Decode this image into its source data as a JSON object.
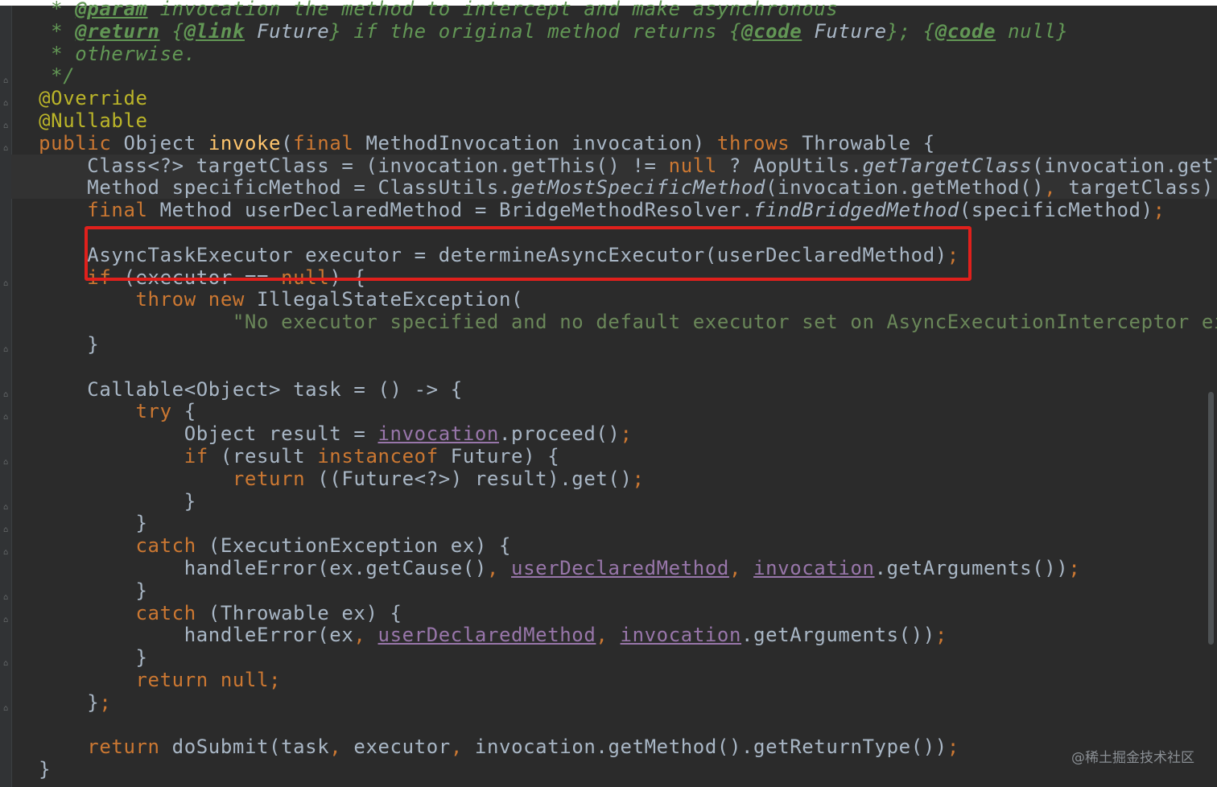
{
  "watermark": "@稀土掘金技术社区",
  "lines": [
    [
      [
        "cmt",
        "   * "
      ],
      [
        "tag",
        "@param"
      ],
      [
        "cmt",
        " invocation the method to intercept and make asynchronous"
      ]
    ],
    [
      [
        "cmt",
        "   * "
      ],
      [
        "tag",
        "@return"
      ],
      [
        "cmt",
        " {"
      ],
      [
        "tag",
        "@link"
      ],
      [
        "cmt",
        " "
      ],
      [
        "cmtp",
        "Future"
      ],
      [
        "cmt",
        "} if the original method returns {"
      ],
      [
        "tag",
        "@code"
      ],
      [
        "cmt",
        " "
      ],
      [
        "cmtp",
        "Future"
      ],
      [
        "cmt",
        "}; {"
      ],
      [
        "tag",
        "@code"
      ],
      [
        "cmt",
        " null}"
      ]
    ],
    [
      [
        "cmt",
        "   * otherwise."
      ]
    ],
    [
      [
        "cmt",
        "   */"
      ]
    ],
    [
      [
        "ann",
        "  @Override"
      ]
    ],
    [
      [
        "ann",
        "  @Nullable"
      ]
    ],
    [
      [
        "kw",
        "  public"
      ],
      [
        "p",
        " Object "
      ],
      [
        "fn",
        "invoke"
      ],
      [
        "p",
        "("
      ],
      [
        "kw",
        "final"
      ],
      [
        "p",
        " MethodInvocation invocation) "
      ],
      [
        "kw",
        "throws"
      ],
      [
        "p",
        " Throwable {"
      ]
    ],
    [
      [
        "p",
        "      Class<?> targetClass = (invocation.getThis() != "
      ],
      [
        "kw",
        "null"
      ],
      [
        "p",
        " ? AopUtils."
      ],
      [
        "st",
        "getTargetClass"
      ],
      [
        "p",
        "(invocation.getTh"
      ]
    ],
    [
      [
        "p",
        "      Method specificMethod = ClassUtils."
      ],
      [
        "st",
        "getMostSpecificMethod"
      ],
      [
        "p",
        "(invocation.getMethod()"
      ],
      [
        "kw",
        ","
      ],
      [
        "p",
        " targetClass)"
      ],
      [
        "kw",
        ";"
      ]
    ],
    [
      [
        "kw",
        "      final"
      ],
      [
        "p",
        " Method userDeclaredMethod = BridgeMethodResolver."
      ],
      [
        "st",
        "findBridgedMethod"
      ],
      [
        "p",
        "(specificMethod)"
      ],
      [
        "kw",
        ";"
      ]
    ],
    [
      [
        "p",
        ""
      ]
    ],
    [
      [
        "p",
        "      AsyncTaskExecutor executor = determineAsyncExecutor(userDeclaredMethod)"
      ],
      [
        "kw",
        ";"
      ]
    ],
    [
      [
        "kw",
        "      if"
      ],
      [
        "p",
        " (executor == "
      ],
      [
        "kw",
        "null"
      ],
      [
        "p",
        ") {"
      ]
    ],
    [
      [
        "kw",
        "          throw new"
      ],
      [
        "p",
        " IllegalStateException("
      ]
    ],
    [
      [
        "str",
        "                  \"No executor specified and no default executor set on AsyncExecutionInterceptor ei"
      ]
    ],
    [
      [
        "p",
        "      }"
      ]
    ],
    [
      [
        "p",
        ""
      ]
    ],
    [
      [
        "p",
        "      Callable<Object> task = () -> {"
      ]
    ],
    [
      [
        "kw",
        "          try"
      ],
      [
        "p",
        " {"
      ]
    ],
    [
      [
        "p",
        "              Object result = "
      ],
      [
        "fld",
        "invocation"
      ],
      [
        "p",
        ".proceed()"
      ],
      [
        "kw",
        ";"
      ]
    ],
    [
      [
        "kw",
        "              if"
      ],
      [
        "p",
        " (result "
      ],
      [
        "kw",
        "instanceof"
      ],
      [
        "p",
        " Future) {"
      ]
    ],
    [
      [
        "kw",
        "                  return"
      ],
      [
        "p",
        " ((Future<?>) result).get()"
      ],
      [
        "kw",
        ";"
      ]
    ],
    [
      [
        "p",
        "              }"
      ]
    ],
    [
      [
        "p",
        "          }"
      ]
    ],
    [
      [
        "kw",
        "          catch"
      ],
      [
        "p",
        " (ExecutionException ex) {"
      ]
    ],
    [
      [
        "p",
        "              handleError(ex.getCause()"
      ],
      [
        "kw",
        ","
      ],
      [
        "p",
        " "
      ],
      [
        "fld",
        "userDeclaredMethod"
      ],
      [
        "kw",
        ","
      ],
      [
        "p",
        " "
      ],
      [
        "fld",
        "invocation"
      ],
      [
        "p",
        ".getArguments())"
      ],
      [
        "kw",
        ";"
      ]
    ],
    [
      [
        "p",
        "          }"
      ]
    ],
    [
      [
        "kw",
        "          catch"
      ],
      [
        "p",
        " (Throwable ex) {"
      ]
    ],
    [
      [
        "p",
        "              handleError(ex"
      ],
      [
        "kw",
        ","
      ],
      [
        "p",
        " "
      ],
      [
        "fld",
        "userDeclaredMethod"
      ],
      [
        "kw",
        ","
      ],
      [
        "p",
        " "
      ],
      [
        "fld",
        "invocation"
      ],
      [
        "p",
        ".getArguments())"
      ],
      [
        "kw",
        ";"
      ]
    ],
    [
      [
        "p",
        "          }"
      ]
    ],
    [
      [
        "kw",
        "          return null;"
      ]
    ],
    [
      [
        "p",
        "      }"
      ],
      [
        "kw",
        ";"
      ]
    ],
    [
      [
        "p",
        ""
      ]
    ],
    [
      [
        "kw",
        "      return"
      ],
      [
        "p",
        " doSubmit(task"
      ],
      [
        "kw",
        ","
      ],
      [
        "p",
        " executor"
      ],
      [
        "kw",
        ","
      ],
      [
        "p",
        " invocation.getMethod().getReturnType())"
      ],
      [
        "kw",
        ";"
      ]
    ],
    [
      [
        "p",
        "  }"
      ]
    ]
  ]
}
